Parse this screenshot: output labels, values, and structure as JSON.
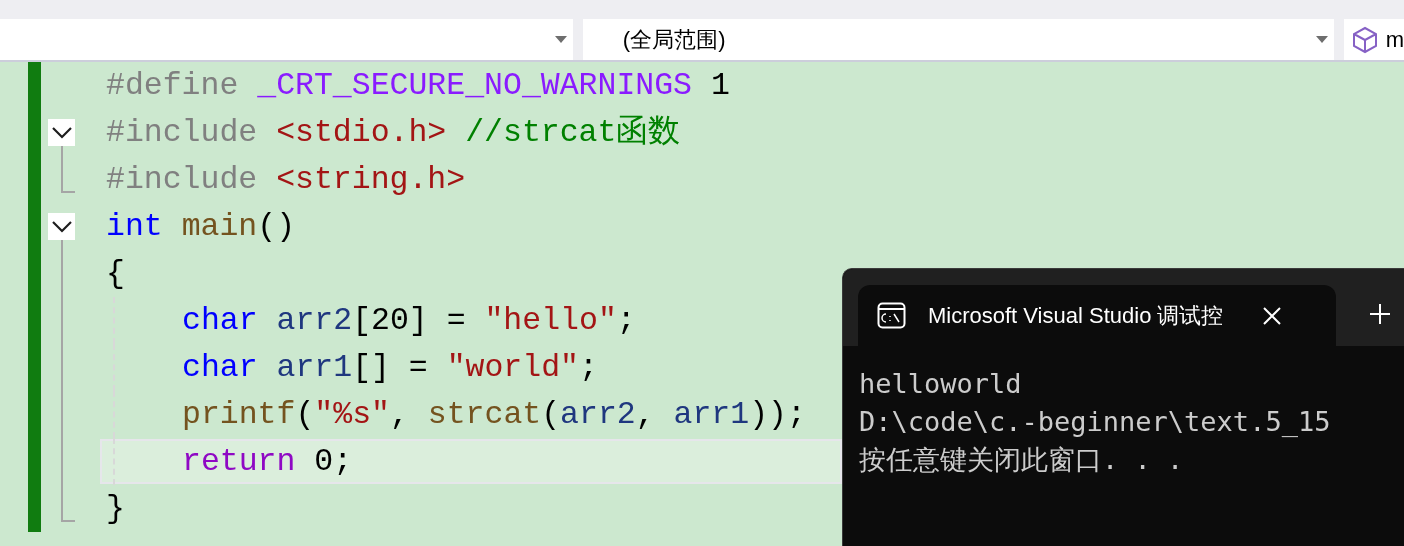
{
  "toolbar": {
    "scope_dropdown": {
      "value": "(全局范围)"
    },
    "member_dropdown": {
      "value": "m"
    }
  },
  "code_lines": [
    {
      "kind": "plain",
      "indented": false,
      "current": false,
      "tokens": [
        {
          "kind": "preproc",
          "text": "#define "
        },
        {
          "kind": "macro",
          "text": "_CRT_SECURE_NO_WARNINGS"
        },
        {
          "kind": "plain",
          "text": " 1"
        }
      ]
    },
    {
      "kind": "fold_start",
      "expanded": true,
      "indented": false,
      "current": false,
      "tokens": [
        {
          "kind": "preproc",
          "text": "#include "
        },
        {
          "kind": "header",
          "text": "<stdio.h>"
        },
        {
          "kind": "comment",
          "text": " //strcat函数"
        }
      ]
    },
    {
      "kind": "fold_end",
      "indented": false,
      "current": false,
      "tokens": [
        {
          "kind": "preproc",
          "text": "#include "
        },
        {
          "kind": "header",
          "text": "<string.h>"
        }
      ]
    },
    {
      "kind": "fold_start",
      "expanded": true,
      "indented": false,
      "current": false,
      "tokens": [
        {
          "kind": "keyword",
          "text": "int "
        },
        {
          "kind": "func",
          "text": "main"
        },
        {
          "kind": "plain",
          "text": "()"
        }
      ]
    },
    {
      "kind": "plain",
      "indented": false,
      "current": false,
      "tokens": [
        {
          "kind": "plain",
          "text": "{"
        }
      ]
    },
    {
      "kind": "plain",
      "indented": true,
      "current": false,
      "tokens": [
        {
          "kind": "keyword",
          "text": "char "
        },
        {
          "kind": "var",
          "text": "arr2"
        },
        {
          "kind": "plain",
          "text": "[20] = "
        },
        {
          "kind": "string",
          "text": "\"hello\""
        },
        {
          "kind": "plain",
          "text": ";"
        }
      ]
    },
    {
      "kind": "plain",
      "indented": true,
      "current": false,
      "tokens": [
        {
          "kind": "keyword",
          "text": "char "
        },
        {
          "kind": "var",
          "text": "arr1"
        },
        {
          "kind": "plain",
          "text": "[] = "
        },
        {
          "kind": "string",
          "text": "\"world\""
        },
        {
          "kind": "plain",
          "text": ";"
        }
      ]
    },
    {
      "kind": "plain",
      "indented": true,
      "current": false,
      "tokens": [
        {
          "kind": "func",
          "text": "printf"
        },
        {
          "kind": "plain",
          "text": "("
        },
        {
          "kind": "string",
          "text": "\"%s\""
        },
        {
          "kind": "plain",
          "text": ", "
        },
        {
          "kind": "func",
          "text": "strcat"
        },
        {
          "kind": "plain",
          "text": "("
        },
        {
          "kind": "var",
          "text": "arr2"
        },
        {
          "kind": "plain",
          "text": ", "
        },
        {
          "kind": "var",
          "text": "arr1"
        },
        {
          "kind": "plain",
          "text": "));"
        }
      ]
    },
    {
      "kind": "plain",
      "indented": true,
      "current": true,
      "tokens": [
        {
          "kind": "control",
          "text": "return"
        },
        {
          "kind": "plain",
          "text": " 0;"
        }
      ]
    },
    {
      "kind": "fold_end",
      "indented": false,
      "current": false,
      "tokens": [
        {
          "kind": "plain",
          "text": "}"
        }
      ]
    }
  ],
  "console": {
    "tab_title": "Microsoft Visual Studio 调试控",
    "tab_selected": true,
    "output": [
      "helloworld",
      "D:\\code\\c.-beginner\\text.5_15",
      "按任意键关闭此窗口. . ."
    ]
  }
}
